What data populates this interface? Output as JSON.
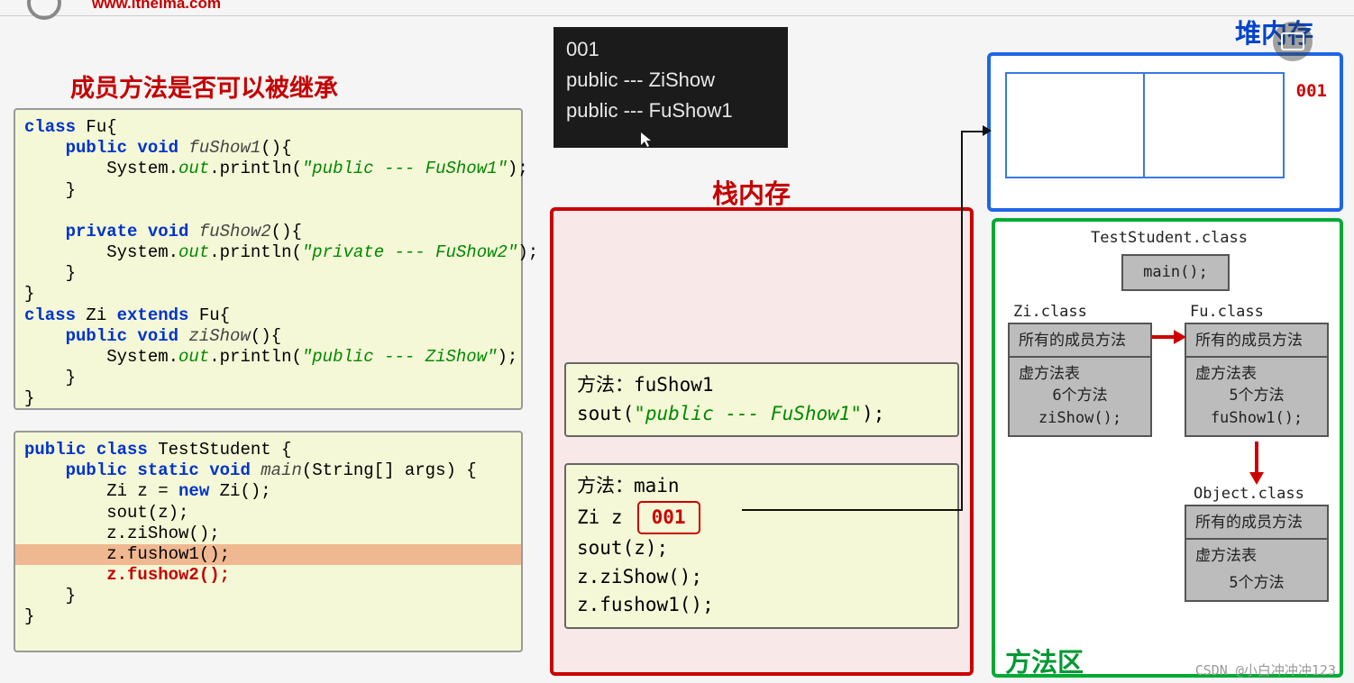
{
  "header": {
    "url": "www.itheima.com"
  },
  "title_left": "成员方法是否可以被继承",
  "console": {
    "l1": "001",
    "l2": "public --- ZiShow",
    "l3": "public --- FuShow1"
  },
  "stack": {
    "title": "栈内存",
    "frame1": {
      "head": "方法：fuShow1",
      "sout_pre": "sout(",
      "sout_str": "\"public --- FuShow1\"",
      "sout_suf": ");"
    },
    "frame2": {
      "head": "方法：main",
      "decl": "Zi z",
      "addr": "001",
      "l2": "sout(z);",
      "l3": "z.ziShow();",
      "l4": "z.fushow1();"
    }
  },
  "heap": {
    "title": "堆内存",
    "addr": "001"
  },
  "method_area": {
    "title": "方法区",
    "test_class": "TestStudent.class",
    "main": "main();",
    "zi_class": "Zi.class",
    "fu_class": "Fu.class",
    "all_methods": "所有的成员方法",
    "vtable": "虚方法表",
    "zi_count": "6个方法",
    "fu_count": "5个方法",
    "zi_m": "ziShow();",
    "fu_m": "fuShow1();",
    "obj_class": "Object.class",
    "obj_count": "5个方法"
  },
  "watermark": "CSDN @小白冲冲冲123",
  "code1": {
    "l1a": "class",
    "l1b": " Fu{",
    "l2a": "    public void ",
    "l2b": "fuShow1",
    "l2c": "(){",
    "l3a": "        System.",
    "l3b": "out",
    "l3c": ".println(",
    "l3d": "\"public --- FuShow1\"",
    "l3e": ");",
    "l4": "    }",
    "blank": "",
    "l5a": "    private void ",
    "l5b": "fuShow2",
    "l5c": "(){",
    "l6a": "        System.",
    "l6b": "out",
    "l6c": ".println(",
    "l6d": "\"private --- FuShow2\"",
    "l6e": ");",
    "l7": "    }",
    "l8": "}",
    "l9a": "class",
    "l9b": " Zi ",
    "l9c": "extends",
    "l9d": " Fu{",
    "l10a": "    public void ",
    "l10b": "ziShow",
    "l10c": "(){",
    "l11a": "        System.",
    "l11b": "out",
    "l11c": ".println(",
    "l11d": "\"public --- ZiShow\"",
    "l11e": ");",
    "l12": "    }",
    "l13": "}"
  },
  "code2": {
    "l1a": "public class ",
    "l1b": "TestStudent {",
    "l2a": "    public static void ",
    "l2b": "main",
    "l2c": "(String[] args) {",
    "l3a": "        Zi z = ",
    "l3b": "new",
    "l3c": " Zi();",
    "l4": "        sout(z);",
    "l5": "        z.ziShow();",
    "l6": "        z.fushow1();",
    "l7": "        z.fushow2();",
    "l8": "    }",
    "l9": "}"
  }
}
